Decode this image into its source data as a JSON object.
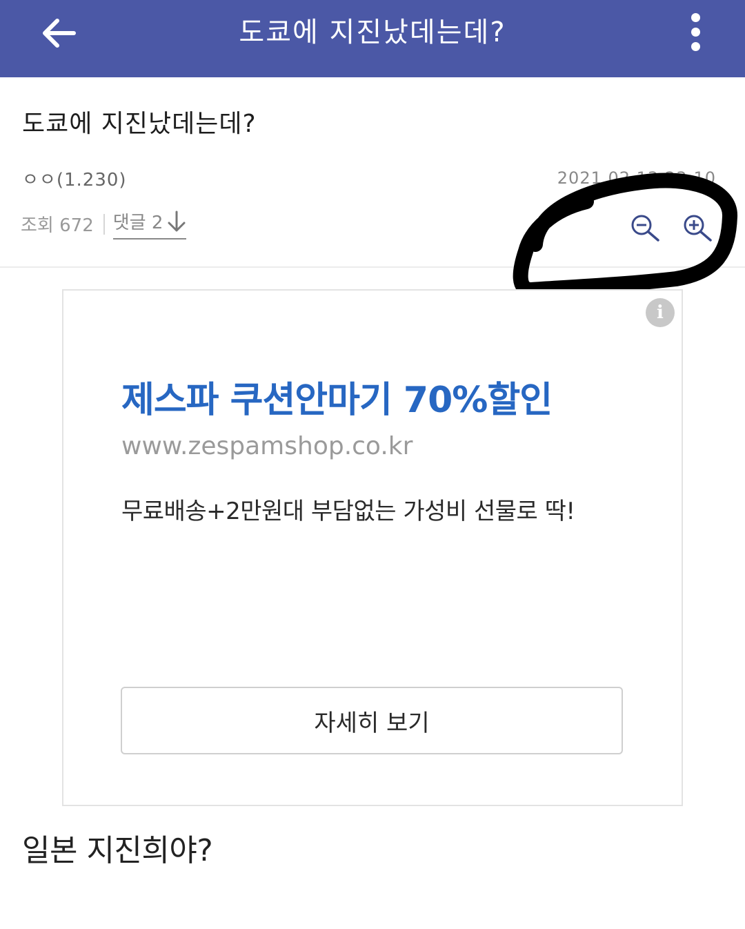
{
  "appbar": {
    "title": "도쿄에 지진났데는데?",
    "back_icon": "arrow-left-icon",
    "more_icon": "more-vertical-icon",
    "background_color": "#4b58a6"
  },
  "post": {
    "title": "도쿄에 지진났데는데?",
    "author": "ㅇㅇ(1.230)",
    "date": "2021.02.13 23:10",
    "views_label": "조회 672",
    "comments_label": "댓글 2",
    "comments_arrow_icon": "arrow-down-icon",
    "zoom_out_icon": "zoom-out-icon",
    "zoom_in_icon": "zoom-in-icon",
    "body_text": "일본 지진희야?"
  },
  "ad": {
    "info_icon": "info-icon",
    "info_glyph": "i",
    "headline": "제스파 쿠션안마기 70%할인",
    "url": "www.zespamshop.co.kr",
    "description": "무료배송+2만원대 부담없는 가성비 선물로 딱!",
    "button_label": "자세히 보기",
    "headline_color": "#2767c2"
  }
}
